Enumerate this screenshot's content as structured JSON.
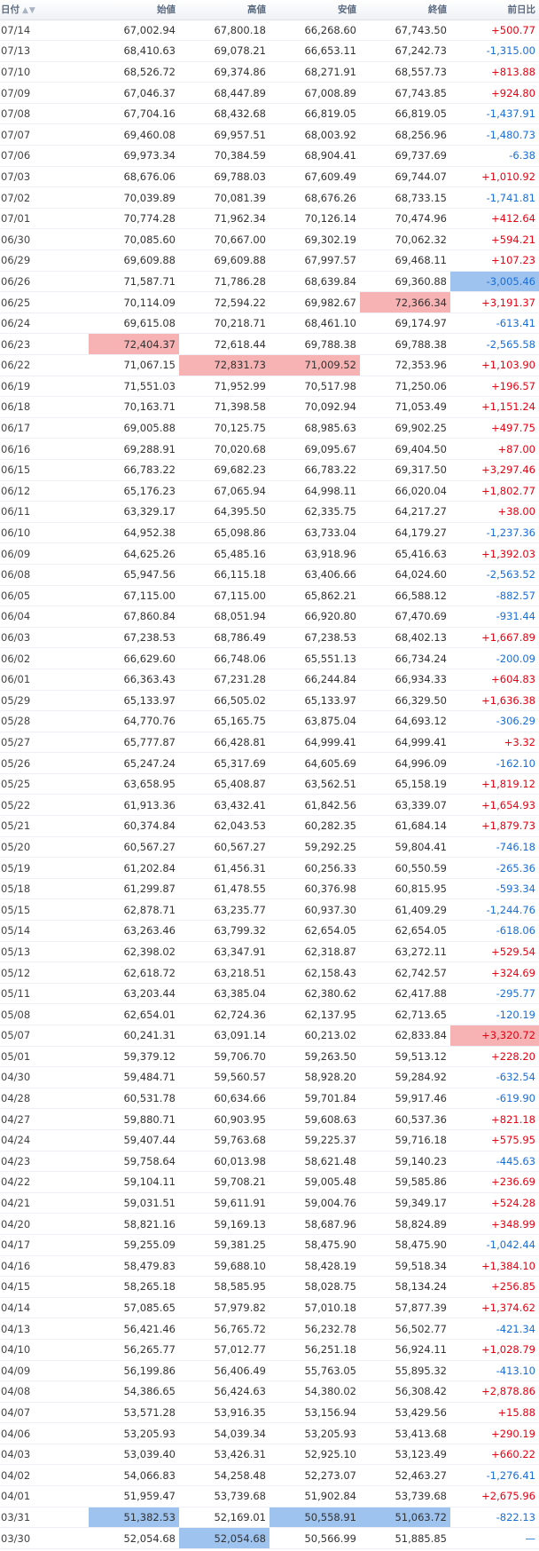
{
  "colors": {
    "up": "#e60012",
    "down": "#1a6ed8",
    "highlight_high": "#f7b3b3",
    "highlight_low": "#9ec3ee"
  },
  "headers": {
    "date": "日付",
    "sort_icon": "▲▼",
    "open": "始値",
    "high": "高値",
    "low": "安値",
    "close": "終値",
    "change": "前日比"
  },
  "rows": [
    {
      "date": "07/14",
      "open": "67,002.94",
      "high": "67,800.18",
      "low": "66,268.60",
      "close": "67,743.50",
      "change": "+500.77",
      "dir": "up",
      "hl": {}
    },
    {
      "date": "07/13",
      "open": "68,410.63",
      "high": "69,078.21",
      "low": "66,653.11",
      "close": "67,242.73",
      "change": "-1,315.00",
      "dir": "down",
      "hl": {}
    },
    {
      "date": "07/10",
      "open": "68,526.72",
      "high": "69,374.86",
      "low": "68,271.91",
      "close": "68,557.73",
      "change": "+813.88",
      "dir": "up",
      "hl": {}
    },
    {
      "date": "07/09",
      "open": "67,046.37",
      "high": "68,447.89",
      "low": "67,008.89",
      "close": "67,743.85",
      "change": "+924.80",
      "dir": "up",
      "hl": {}
    },
    {
      "date": "07/08",
      "open": "67,704.16",
      "high": "68,432.68",
      "low": "66,819.05",
      "close": "66,819.05",
      "change": "-1,437.91",
      "dir": "down",
      "hl": {}
    },
    {
      "date": "07/07",
      "open": "69,460.08",
      "high": "69,957.51",
      "low": "68,003.92",
      "close": "68,256.96",
      "change": "-1,480.73",
      "dir": "down",
      "hl": {}
    },
    {
      "date": "07/06",
      "open": "69,973.34",
      "high": "70,384.59",
      "low": "68,904.41",
      "close": "69,737.69",
      "change": "-6.38",
      "dir": "down",
      "hl": {}
    },
    {
      "date": "07/03",
      "open": "68,676.06",
      "high": "69,788.03",
      "low": "67,609.49",
      "close": "69,744.07",
      "change": "+1,010.92",
      "dir": "up",
      "hl": {}
    },
    {
      "date": "07/02",
      "open": "70,039.89",
      "high": "70,081.39",
      "low": "68,676.26",
      "close": "68,733.15",
      "change": "-1,741.81",
      "dir": "down",
      "hl": {}
    },
    {
      "date": "07/01",
      "open": "70,774.28",
      "high": "71,962.34",
      "low": "70,126.14",
      "close": "70,474.96",
      "change": "+412.64",
      "dir": "up",
      "hl": {}
    },
    {
      "date": "06/30",
      "open": "70,085.60",
      "high": "70,667.00",
      "low": "69,302.19",
      "close": "70,062.32",
      "change": "+594.21",
      "dir": "up",
      "hl": {}
    },
    {
      "date": "06/29",
      "open": "69,609.88",
      "high": "69,609.88",
      "low": "67,997.57",
      "close": "69,468.11",
      "change": "+107.23",
      "dir": "up",
      "hl": {}
    },
    {
      "date": "06/26",
      "open": "71,587.71",
      "high": "71,786.28",
      "low": "68,639.84",
      "close": "69,360.88",
      "change": "-3,005.46",
      "dir": "down",
      "hl": {
        "change": "low"
      }
    },
    {
      "date": "06/25",
      "open": "70,114.09",
      "high": "72,594.22",
      "low": "69,982.67",
      "close": "72,366.34",
      "change": "+3,191.37",
      "dir": "up",
      "hl": {
        "close": "high"
      }
    },
    {
      "date": "06/24",
      "open": "69,615.08",
      "high": "70,218.71",
      "low": "68,461.10",
      "close": "69,174.97",
      "change": "-613.41",
      "dir": "down",
      "hl": {}
    },
    {
      "date": "06/23",
      "open": "72,404.37",
      "high": "72,618.44",
      "low": "69,788.38",
      "close": "69,788.38",
      "change": "-2,565.58",
      "dir": "down",
      "hl": {
        "open": "high"
      }
    },
    {
      "date": "06/22",
      "open": "71,067.15",
      "high": "72,831.73",
      "low": "71,009.52",
      "close": "72,353.96",
      "change": "+1,103.90",
      "dir": "up",
      "hl": {
        "high": "high",
        "low": "high"
      }
    },
    {
      "date": "06/19",
      "open": "71,551.03",
      "high": "71,952.99",
      "low": "70,517.98",
      "close": "71,250.06",
      "change": "+196.57",
      "dir": "up",
      "hl": {}
    },
    {
      "date": "06/18",
      "open": "70,163.71",
      "high": "71,398.58",
      "low": "70,092.94",
      "close": "71,053.49",
      "change": "+1,151.24",
      "dir": "up",
      "hl": {}
    },
    {
      "date": "06/17",
      "open": "69,005.88",
      "high": "70,125.75",
      "low": "68,985.63",
      "close": "69,902.25",
      "change": "+497.75",
      "dir": "up",
      "hl": {}
    },
    {
      "date": "06/16",
      "open": "69,288.91",
      "high": "70,020.68",
      "low": "69,095.67",
      "close": "69,404.50",
      "change": "+87.00",
      "dir": "up",
      "hl": {}
    },
    {
      "date": "06/15",
      "open": "66,783.22",
      "high": "69,682.23",
      "low": "66,783.22",
      "close": "69,317.50",
      "change": "+3,297.46",
      "dir": "up",
      "hl": {}
    },
    {
      "date": "06/12",
      "open": "65,176.23",
      "high": "67,065.94",
      "low": "64,998.11",
      "close": "66,020.04",
      "change": "+1,802.77",
      "dir": "up",
      "hl": {}
    },
    {
      "date": "06/11",
      "open": "63,329.17",
      "high": "64,395.50",
      "low": "62,335.75",
      "close": "64,217.27",
      "change": "+38.00",
      "dir": "up",
      "hl": {}
    },
    {
      "date": "06/10",
      "open": "64,952.38",
      "high": "65,098.86",
      "low": "63,733.04",
      "close": "64,179.27",
      "change": "-1,237.36",
      "dir": "down",
      "hl": {}
    },
    {
      "date": "06/09",
      "open": "64,625.26",
      "high": "65,485.16",
      "low": "63,918.96",
      "close": "65,416.63",
      "change": "+1,392.03",
      "dir": "up",
      "hl": {}
    },
    {
      "date": "06/08",
      "open": "65,947.56",
      "high": "66,115.18",
      "low": "63,406.66",
      "close": "64,024.60",
      "change": "-2,563.52",
      "dir": "down",
      "hl": {}
    },
    {
      "date": "06/05",
      "open": "67,115.00",
      "high": "67,115.00",
      "low": "65,862.21",
      "close": "66,588.12",
      "change": "-882.57",
      "dir": "down",
      "hl": {}
    },
    {
      "date": "06/04",
      "open": "67,860.84",
      "high": "68,051.94",
      "low": "66,920.80",
      "close": "67,470.69",
      "change": "-931.44",
      "dir": "down",
      "hl": {}
    },
    {
      "date": "06/03",
      "open": "67,238.53",
      "high": "68,786.49",
      "low": "67,238.53",
      "close": "68,402.13",
      "change": "+1,667.89",
      "dir": "up",
      "hl": {}
    },
    {
      "date": "06/02",
      "open": "66,629.60",
      "high": "66,748.06",
      "low": "65,551.13",
      "close": "66,734.24",
      "change": "-200.09",
      "dir": "down",
      "hl": {}
    },
    {
      "date": "06/01",
      "open": "66,363.43",
      "high": "67,231.28",
      "low": "66,244.84",
      "close": "66,934.33",
      "change": "+604.83",
      "dir": "up",
      "hl": {}
    },
    {
      "date": "05/29",
      "open": "65,133.97",
      "high": "66,505.02",
      "low": "65,133.97",
      "close": "66,329.50",
      "change": "+1,636.38",
      "dir": "up",
      "hl": {}
    },
    {
      "date": "05/28",
      "open": "64,770.76",
      "high": "65,165.75",
      "low": "63,875.04",
      "close": "64,693.12",
      "change": "-306.29",
      "dir": "down",
      "hl": {}
    },
    {
      "date": "05/27",
      "open": "65,777.87",
      "high": "66,428.81",
      "low": "64,999.41",
      "close": "64,999.41",
      "change": "+3.32",
      "dir": "up",
      "hl": {}
    },
    {
      "date": "05/26",
      "open": "65,247.24",
      "high": "65,317.69",
      "low": "64,605.69",
      "close": "64,996.09",
      "change": "-162.10",
      "dir": "down",
      "hl": {}
    },
    {
      "date": "05/25",
      "open": "63,658.95",
      "high": "65,408.87",
      "low": "63,562.51",
      "close": "65,158.19",
      "change": "+1,819.12",
      "dir": "up",
      "hl": {}
    },
    {
      "date": "05/22",
      "open": "61,913.36",
      "high": "63,432.41",
      "low": "61,842.56",
      "close": "63,339.07",
      "change": "+1,654.93",
      "dir": "up",
      "hl": {}
    },
    {
      "date": "05/21",
      "open": "60,374.84",
      "high": "62,043.53",
      "low": "60,282.35",
      "close": "61,684.14",
      "change": "+1,879.73",
      "dir": "up",
      "hl": {}
    },
    {
      "date": "05/20",
      "open": "60,567.27",
      "high": "60,567.27",
      "low": "59,292.25",
      "close": "59,804.41",
      "change": "-746.18",
      "dir": "down",
      "hl": {}
    },
    {
      "date": "05/19",
      "open": "61,202.84",
      "high": "61,456.31",
      "low": "60,256.33",
      "close": "60,550.59",
      "change": "-265.36",
      "dir": "down",
      "hl": {}
    },
    {
      "date": "05/18",
      "open": "61,299.87",
      "high": "61,478.55",
      "low": "60,376.98",
      "close": "60,815.95",
      "change": "-593.34",
      "dir": "down",
      "hl": {}
    },
    {
      "date": "05/15",
      "open": "62,878.71",
      "high": "63,235.77",
      "low": "60,937.30",
      "close": "61,409.29",
      "change": "-1,244.76",
      "dir": "down",
      "hl": {}
    },
    {
      "date": "05/14",
      "open": "63,263.46",
      "high": "63,799.32",
      "low": "62,654.05",
      "close": "62,654.05",
      "change": "-618.06",
      "dir": "down",
      "hl": {}
    },
    {
      "date": "05/13",
      "open": "62,398.02",
      "high": "63,347.91",
      "low": "62,318.87",
      "close": "63,272.11",
      "change": "+529.54",
      "dir": "up",
      "hl": {}
    },
    {
      "date": "05/12",
      "open": "62,618.72",
      "high": "63,218.51",
      "low": "62,158.43",
      "close": "62,742.57",
      "change": "+324.69",
      "dir": "up",
      "hl": {}
    },
    {
      "date": "05/11",
      "open": "63,203.44",
      "high": "63,385.04",
      "low": "62,380.62",
      "close": "62,417.88",
      "change": "-295.77",
      "dir": "down",
      "hl": {}
    },
    {
      "date": "05/08",
      "open": "62,654.01",
      "high": "62,724.36",
      "low": "62,137.95",
      "close": "62,713.65",
      "change": "-120.19",
      "dir": "down",
      "hl": {}
    },
    {
      "date": "05/07",
      "open": "60,241.31",
      "high": "63,091.14",
      "low": "60,213.02",
      "close": "62,833.84",
      "change": "+3,320.72",
      "dir": "up",
      "hl": {
        "change": "high"
      }
    },
    {
      "date": "05/01",
      "open": "59,379.12",
      "high": "59,706.70",
      "low": "59,263.50",
      "close": "59,513.12",
      "change": "+228.20",
      "dir": "up",
      "hl": {}
    },
    {
      "date": "04/30",
      "open": "59,484.71",
      "high": "59,560.57",
      "low": "58,928.20",
      "close": "59,284.92",
      "change": "-632.54",
      "dir": "down",
      "hl": {}
    },
    {
      "date": "04/28",
      "open": "60,531.78",
      "high": "60,634.66",
      "low": "59,701.84",
      "close": "59,917.46",
      "change": "-619.90",
      "dir": "down",
      "hl": {}
    },
    {
      "date": "04/27",
      "open": "59,880.71",
      "high": "60,903.95",
      "low": "59,608.63",
      "close": "60,537.36",
      "change": "+821.18",
      "dir": "up",
      "hl": {}
    },
    {
      "date": "04/24",
      "open": "59,407.44",
      "high": "59,763.68",
      "low": "59,225.37",
      "close": "59,716.18",
      "change": "+575.95",
      "dir": "up",
      "hl": {}
    },
    {
      "date": "04/23",
      "open": "59,758.64",
      "high": "60,013.98",
      "low": "58,621.48",
      "close": "59,140.23",
      "change": "-445.63",
      "dir": "down",
      "hl": {}
    },
    {
      "date": "04/22",
      "open": "59,104.11",
      "high": "59,708.21",
      "low": "59,005.48",
      "close": "59,585.86",
      "change": "+236.69",
      "dir": "up",
      "hl": {}
    },
    {
      "date": "04/21",
      "open": "59,031.51",
      "high": "59,611.91",
      "low": "59,004.76",
      "close": "59,349.17",
      "change": "+524.28",
      "dir": "up",
      "hl": {}
    },
    {
      "date": "04/20",
      "open": "58,821.16",
      "high": "59,169.13",
      "low": "58,687.96",
      "close": "58,824.89",
      "change": "+348.99",
      "dir": "up",
      "hl": {}
    },
    {
      "date": "04/17",
      "open": "59,255.09",
      "high": "59,381.25",
      "low": "58,475.90",
      "close": "58,475.90",
      "change": "-1,042.44",
      "dir": "down",
      "hl": {}
    },
    {
      "date": "04/16",
      "open": "58,479.83",
      "high": "59,688.10",
      "low": "58,428.19",
      "close": "59,518.34",
      "change": "+1,384.10",
      "dir": "up",
      "hl": {}
    },
    {
      "date": "04/15",
      "open": "58,265.18",
      "high": "58,585.95",
      "low": "58,028.75",
      "close": "58,134.24",
      "change": "+256.85",
      "dir": "up",
      "hl": {}
    },
    {
      "date": "04/14",
      "open": "57,085.65",
      "high": "57,979.82",
      "low": "57,010.18",
      "close": "57,877.39",
      "change": "+1,374.62",
      "dir": "up",
      "hl": {}
    },
    {
      "date": "04/13",
      "open": "56,421.46",
      "high": "56,765.72",
      "low": "56,232.78",
      "close": "56,502.77",
      "change": "-421.34",
      "dir": "down",
      "hl": {}
    },
    {
      "date": "04/10",
      "open": "56,265.77",
      "high": "57,012.77",
      "low": "56,251.18",
      "close": "56,924.11",
      "change": "+1,028.79",
      "dir": "up",
      "hl": {}
    },
    {
      "date": "04/09",
      "open": "56,199.86",
      "high": "56,406.49",
      "low": "55,763.05",
      "close": "55,895.32",
      "change": "-413.10",
      "dir": "down",
      "hl": {}
    },
    {
      "date": "04/08",
      "open": "54,386.65",
      "high": "56,424.63",
      "low": "54,380.02",
      "close": "56,308.42",
      "change": "+2,878.86",
      "dir": "up",
      "hl": {}
    },
    {
      "date": "04/07",
      "open": "53,571.28",
      "high": "53,916.35",
      "low": "53,156.94",
      "close": "53,429.56",
      "change": "+15.88",
      "dir": "up",
      "hl": {}
    },
    {
      "date": "04/06",
      "open": "53,205.93",
      "high": "54,039.34",
      "low": "53,205.93",
      "close": "53,413.68",
      "change": "+290.19",
      "dir": "up",
      "hl": {}
    },
    {
      "date": "04/03",
      "open": "53,039.40",
      "high": "53,426.31",
      "low": "52,925.10",
      "close": "53,123.49",
      "change": "+660.22",
      "dir": "up",
      "hl": {}
    },
    {
      "date": "04/02",
      "open": "54,066.83",
      "high": "54,258.48",
      "low": "52,273.07",
      "close": "52,463.27",
      "change": "-1,276.41",
      "dir": "down",
      "hl": {}
    },
    {
      "date": "04/01",
      "open": "51,959.47",
      "high": "53,739.68",
      "low": "51,902.84",
      "close": "53,739.68",
      "change": "+2,675.96",
      "dir": "up",
      "hl": {}
    },
    {
      "date": "03/31",
      "open": "51,382.53",
      "high": "52,169.01",
      "low": "50,558.91",
      "close": "51,063.72",
      "change": "-822.13",
      "dir": "down",
      "hl": {
        "open": "low",
        "low": "low",
        "close": "low"
      }
    },
    {
      "date": "03/30",
      "open": "52,054.68",
      "high": "52,054.68",
      "low": "50,566.99",
      "close": "51,885.85",
      "change": "—",
      "dir": "down",
      "hl": {
        "high": "low"
      }
    }
  ]
}
